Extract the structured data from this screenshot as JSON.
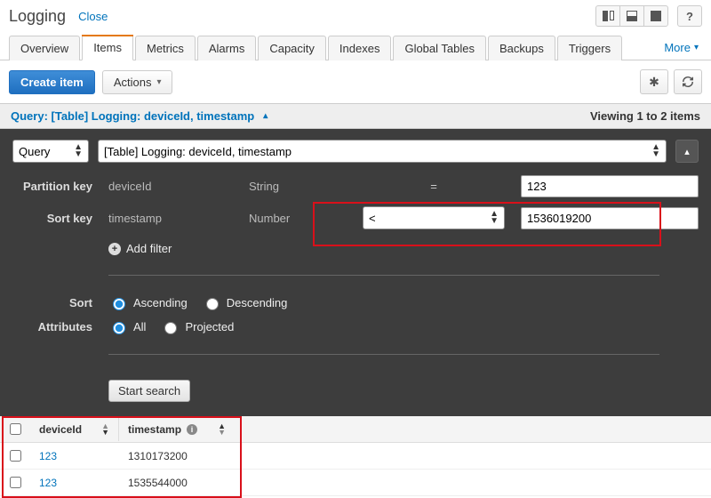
{
  "header": {
    "title": "Logging",
    "close": "Close"
  },
  "tabs": [
    "Overview",
    "Items",
    "Metrics",
    "Alarms",
    "Capacity",
    "Indexes",
    "Global Tables",
    "Backups",
    "Triggers"
  ],
  "more": "More",
  "toolbar": {
    "create": "Create item",
    "actions": "Actions"
  },
  "queryHeader": {
    "label": "Query: [Table] Logging: deviceId, timestamp",
    "viewing": "Viewing 1 to 2 items"
  },
  "panel": {
    "modeSelect": "Query",
    "tableSelect": "[Table] Logging: deviceId, timestamp",
    "partition": {
      "label": "Partition key",
      "name": "deviceId",
      "type": "String",
      "op": "=",
      "value": "123"
    },
    "sort": {
      "label": "Sort key",
      "name": "timestamp",
      "type": "Number",
      "op": "<",
      "value": "1536019200"
    },
    "addFilter": "Add filter",
    "sortLabel": "Sort",
    "asc": "Ascending",
    "desc": "Descending",
    "attrLabel": "Attributes",
    "all": "All",
    "proj": "Projected",
    "start": "Start search"
  },
  "results": {
    "cols": {
      "device": "deviceId",
      "ts": "timestamp"
    },
    "rows": [
      {
        "deviceId": "123",
        "timestamp": "1310173200"
      },
      {
        "deviceId": "123",
        "timestamp": "1535544000"
      }
    ]
  }
}
